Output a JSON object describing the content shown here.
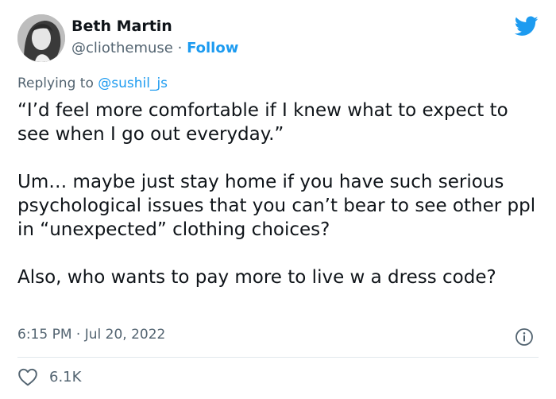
{
  "author": {
    "name": "Beth Martin",
    "handle": "@cliothemuse",
    "separator": "·",
    "follow_label": "Follow"
  },
  "reply": {
    "prefix": "Replying to",
    "mention": "@sushil_js"
  },
  "tweet": {
    "paragraphs": [
      "“I’d feel more comfortable if I knew what to expect to see when I go out everyday.”",
      "Um… maybe just stay home if you have such serious psychological issues that you can’t bear to see other ppl in “unexpected” clothing choices?",
      "Also, who wants to pay more to live w a dress code?"
    ],
    "timestamp": "6:15 PM · Jul 20, 2022"
  },
  "stats": {
    "likes": "6.1K"
  },
  "colors": {
    "accent": "#1d9bf0",
    "secondary_text": "#536471",
    "primary_text": "#0f1419",
    "divider": "#e1e8ed"
  },
  "icons": {
    "brand": "twitter-bird-icon",
    "info": "info-icon",
    "like": "heart-icon",
    "avatar": "profile-photo"
  }
}
